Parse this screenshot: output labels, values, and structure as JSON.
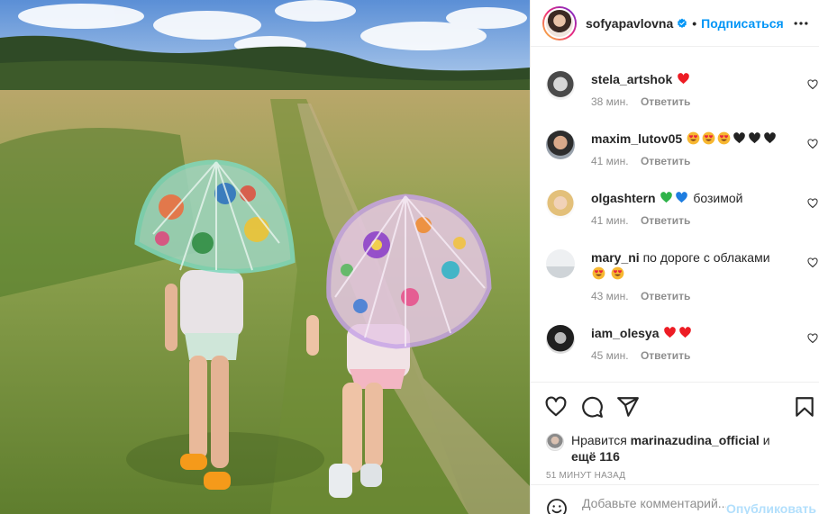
{
  "post": {
    "owner": "sofyapavlovna",
    "verified": true,
    "follow_label": "Подписаться",
    "more_icon": "more-horizontal-icon"
  },
  "comments": [
    {
      "user": "stela_artshok",
      "text": "",
      "emoji": [
        "red-heart"
      ],
      "time": "38 мин.",
      "reply": "Ответить"
    },
    {
      "user": "maxim_lutov05",
      "text": "",
      "emoji": [
        "heart-eyes",
        "heart-eyes",
        "heart-eyes",
        "black-heart",
        "black-heart",
        "black-heart"
      ],
      "time": "41 мин.",
      "reply": "Ответить"
    },
    {
      "user": "olgashtern",
      "text": "бозимой",
      "emoji": [
        "green-heart",
        "blue-heart"
      ],
      "time": "41 мин.",
      "reply": "Ответить"
    },
    {
      "user": "mary_ni",
      "text": "по дороге с облаками",
      "emoji": [
        "heart-eyes",
        "heart-eyes"
      ],
      "time": "43 мин.",
      "reply": "Ответить"
    },
    {
      "user": "iam_olesya",
      "text": "",
      "emoji": [
        "red-heart",
        "red-heart"
      ],
      "time": "45 мин.",
      "reply": "Ответить"
    }
  ],
  "likes": {
    "prefix": "Нравится",
    "user": "marinazudina_official",
    "and": "и",
    "others": "ещё 116"
  },
  "post_time": "51 минут назад",
  "add_comment": {
    "placeholder": "Добавьте комментарий...",
    "publish_label": "Опубликовать"
  },
  "colors": {
    "accent": "#0095f6",
    "publish_disabled": "#b2dffc",
    "meta": "#8e8e8e",
    "red_heart": "#ed4956"
  }
}
